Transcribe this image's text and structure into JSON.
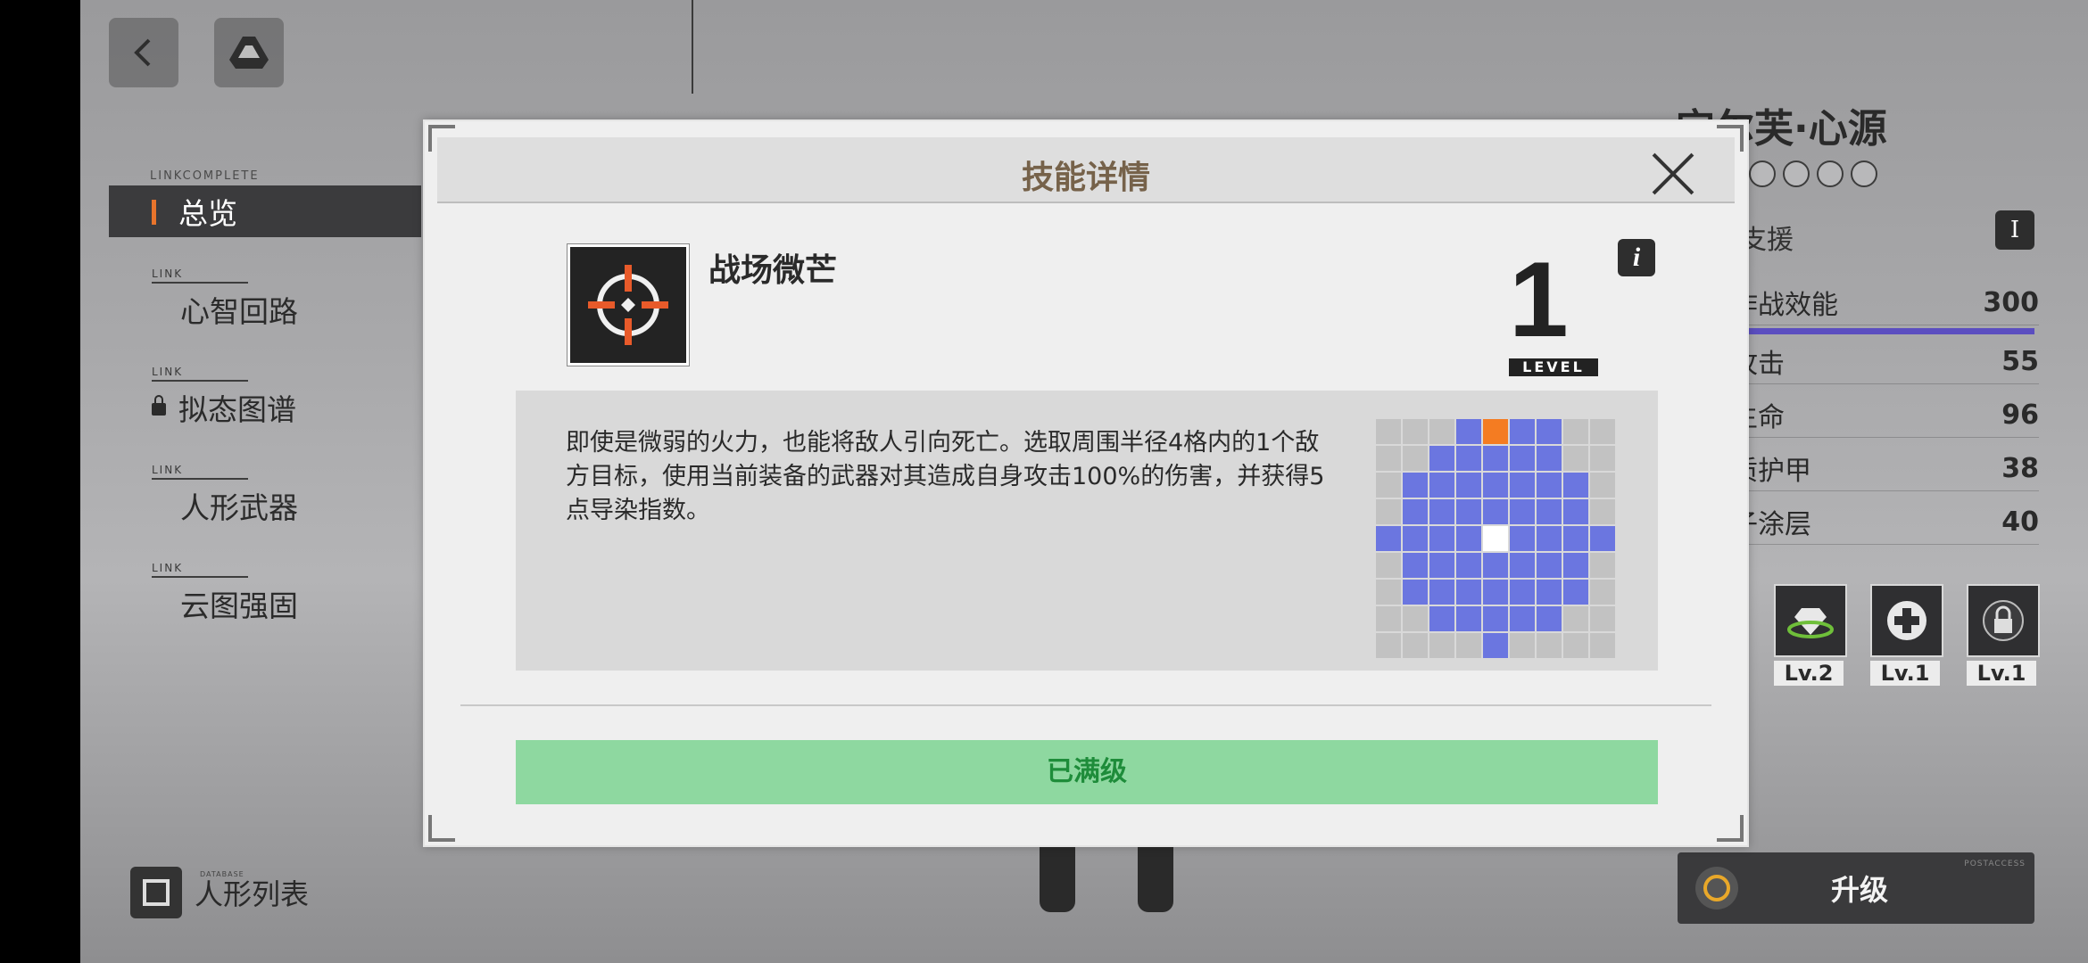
{
  "top_buttons": [
    {
      "icon": "back-arrow-icon"
    },
    {
      "icon": "drive-icon"
    }
  ],
  "nav": {
    "header": "LINKCOMPLETE",
    "items": [
      {
        "label": "总览",
        "active": true
      },
      {
        "label": "心智回路",
        "tag": "LINK"
      },
      {
        "label": "拟态图谱",
        "tag": "LINK",
        "locked": true
      },
      {
        "label": "人形武器",
        "tag": "LINK"
      },
      {
        "label": "云图强固",
        "tag": "LINK"
      }
    ]
  },
  "list_button": {
    "label": "人形列表",
    "tag": "DATABASE"
  },
  "character": {
    "name": "宝尔芙·心源",
    "role": "支援",
    "role_badge": "I",
    "stats": [
      {
        "label": "作战效能",
        "value": "300"
      },
      {
        "label": "攻击",
        "value": "55"
      },
      {
        "label": "生命",
        "value": "96"
      },
      {
        "label": "质护甲",
        "value": "38"
      },
      {
        "label": "子涂层",
        "value": "40"
      }
    ],
    "skills": [
      {
        "level": "Lv.2",
        "icon": "diamond-icon"
      },
      {
        "level": "Lv.1",
        "icon": "heal-plus-icon"
      },
      {
        "level": "Lv.1",
        "icon": "lock-icon"
      }
    ],
    "upgrade_label": "升级",
    "upgrade_tag": "POSTACCESS"
  },
  "dialog": {
    "title": "技能详情",
    "skill_name": "战场微芒",
    "skill_icon": "crosshair-icon",
    "level": "1",
    "level_tag": "LEVEL",
    "info_label": "i",
    "description": "即使是微弱的火力，也能将敌人引向死亡。选取周围半径4格内的1个敌方目标，使用当前装备的武器对其造成自身攻击100%的伤害，并获得5点导染指数。",
    "range_grid": [
      "...RRRR..",
      "..RRRRR..",
      ".RRRRRRR.",
      ".RRRRRRR.",
      "RRRRCRRRR",
      ".RRRRRRR.",
      ".RRRRRRR.",
      "..RRRRR..",
      "....R...."
    ],
    "marker_row": "....O....",
    "max_label": "已满级"
  }
}
